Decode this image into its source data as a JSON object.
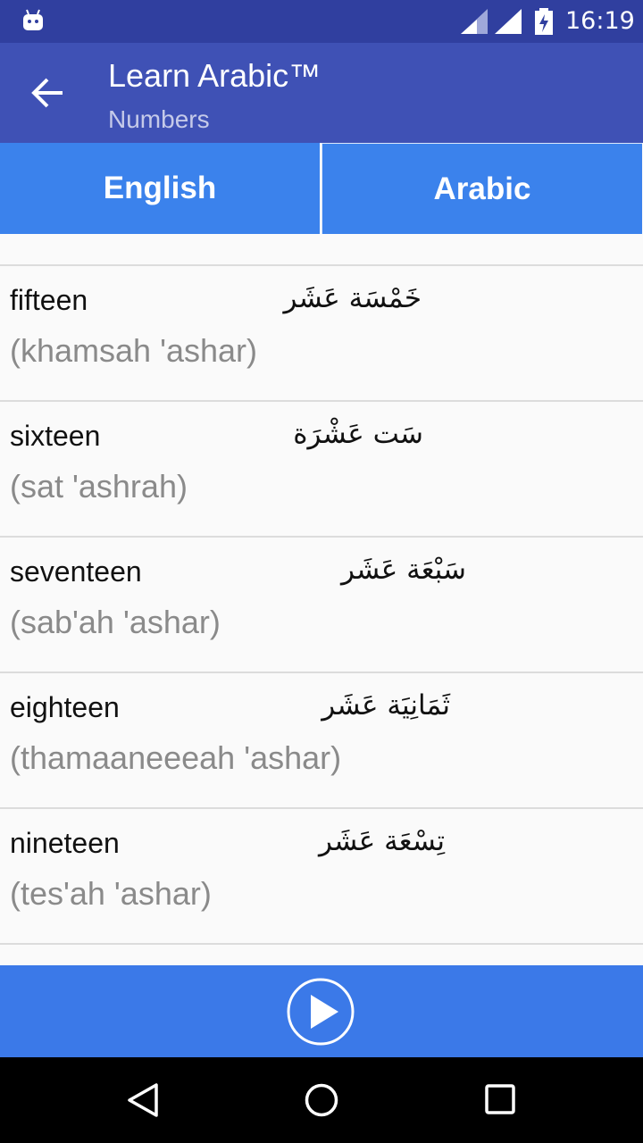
{
  "status_bar": {
    "time": "16:19"
  },
  "app_bar": {
    "title": "Learn Arabic™",
    "subtitle": "Numbers"
  },
  "tabs": [
    {
      "label": "English"
    },
    {
      "label": "Arabic"
    }
  ],
  "rows": [
    {
      "english": "fifteen",
      "transliteration": "(khamsah 'ashar)",
      "arabic": "خَمْسَة عَشَر"
    },
    {
      "english": "sixteen",
      "transliteration": "(sat 'ashrah)",
      "arabic": "سَت عَشْرَة"
    },
    {
      "english": "seventeen",
      "transliteration": "(sab'ah 'ashar)",
      "arabic": "سَبْعَة عَشَر"
    },
    {
      "english": "eighteen",
      "transliteration": "(thamaaneeeah 'ashar)",
      "arabic": "ثَمَانِيَة عَشَر"
    },
    {
      "english": "nineteen",
      "transliteration": "(tes'ah 'ashar)",
      "arabic": "تِسْعَة عَشَر"
    }
  ],
  "colors": {
    "status_bar": "#303f9f",
    "app_bar": "#3f51b5",
    "tab": "#3b82ec",
    "play_bar": "#3b79e8"
  }
}
